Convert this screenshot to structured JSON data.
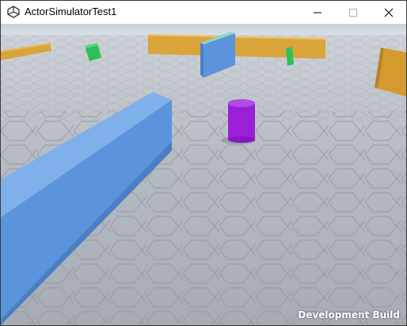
{
  "window": {
    "title": "ActorSimulatorTest1",
    "app_icon": "unity-logo-icon",
    "controls": {
      "minimize": "minimize-icon",
      "maximize": "maximize-icon",
      "close": "close-icon"
    }
  },
  "viewport": {
    "overlay_text": "Development Build",
    "colors": {
      "sky": "#dfe6ee",
      "floor": "#b9bec6",
      "wall_blue": "#5b94dc",
      "wall_orange": "#d9a43a",
      "cube_green": "#2fbf5a",
      "cylinder_purple": "#9b1fd6"
    }
  }
}
